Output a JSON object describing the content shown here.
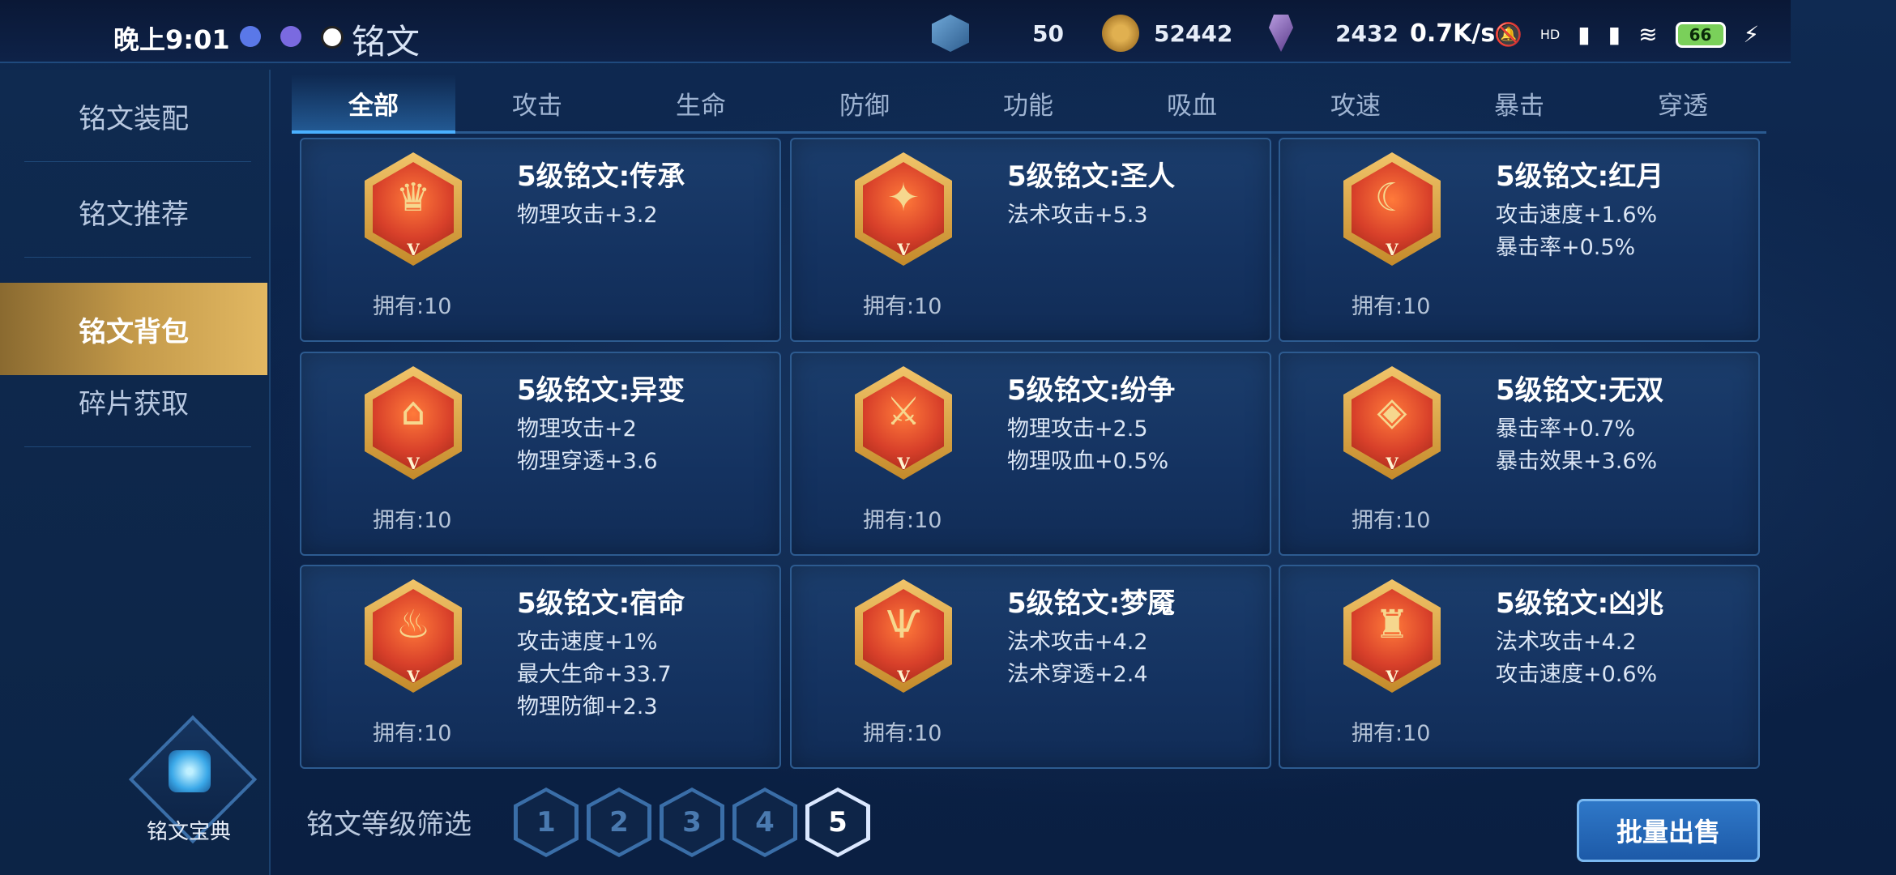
{
  "status_bar": {
    "time": "晚上9:01",
    "app_title": "铭文",
    "net_speed": "0.7K/s",
    "battery": "66",
    "signal_label": "HD"
  },
  "resources": [
    {
      "icon": "crystal-icon",
      "value": "50"
    },
    {
      "icon": "gold-coin-icon",
      "value": "52442"
    },
    {
      "icon": "gem-icon",
      "value": "2432"
    }
  ],
  "sidebar": {
    "items": [
      {
        "label": "铭文装配",
        "active": false
      },
      {
        "label": "铭文推荐",
        "active": false
      },
      {
        "label": "铭文背包",
        "active": true
      },
      {
        "label": "碎片获取",
        "active": false
      }
    ],
    "codex_label": "铭文宝典"
  },
  "tabs": [
    "全部",
    "攻击",
    "生命",
    "防御",
    "功能",
    "吸血",
    "攻速",
    "暴击",
    "穿透"
  ],
  "active_tab": "全部",
  "cards": [
    {
      "name": "5级铭文:传承",
      "stats": [
        "物理攻击+3.2"
      ],
      "owned": "拥有:10",
      "glyph": "♛"
    },
    {
      "name": "5级铭文:圣人",
      "stats": [
        "法术攻击+5.3"
      ],
      "owned": "拥有:10",
      "glyph": "✦"
    },
    {
      "name": "5级铭文:红月",
      "stats": [
        "攻击速度+1.6%",
        "暴击率+0.5%"
      ],
      "owned": "拥有:10",
      "glyph": "☾"
    },
    {
      "name": "5级铭文:异变",
      "stats": [
        "物理攻击+2",
        "物理穿透+3.6"
      ],
      "owned": "拥有:10",
      "glyph": "⌂"
    },
    {
      "name": "5级铭文:纷争",
      "stats": [
        "物理攻击+2.5",
        "物理吸血+0.5%"
      ],
      "owned": "拥有:10",
      "glyph": "⚔"
    },
    {
      "name": "5级铭文:无双",
      "stats": [
        "暴击率+0.7%",
        "暴击效果+3.6%"
      ],
      "owned": "拥有:10",
      "glyph": "◈"
    },
    {
      "name": "5级铭文:宿命",
      "stats": [
        "攻击速度+1%",
        "最大生命+33.7",
        "物理防御+2.3"
      ],
      "owned": "拥有:10",
      "glyph": "♨"
    },
    {
      "name": "5级铭文:梦魇",
      "stats": [
        "法术攻击+4.2",
        "法术穿透+2.4"
      ],
      "owned": "拥有:10",
      "glyph": "Ѱ"
    },
    {
      "name": "5级铭文:凶兆",
      "stats": [
        "法术攻击+4.2",
        "攻击速度+0.6%"
      ],
      "owned": "拥有:10",
      "glyph": "♜"
    }
  ],
  "level_filter": {
    "label": "铭文等级筛选",
    "levels": [
      "1",
      "2",
      "3",
      "4",
      "5"
    ],
    "active": "5"
  },
  "sell_button": "批量出售"
}
